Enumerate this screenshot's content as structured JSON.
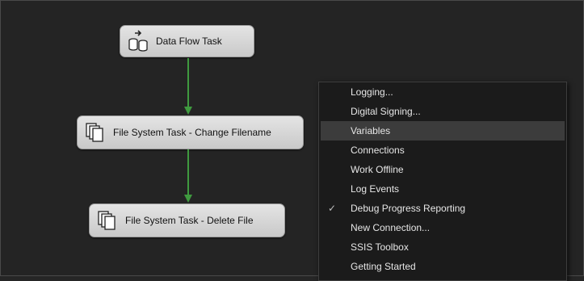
{
  "tasks": [
    {
      "label": "Data Flow Task",
      "icon": "data-flow-icon"
    },
    {
      "label": "File System Task - Change Filename",
      "icon": "file-system-icon"
    },
    {
      "label": "File System Task - Delete File",
      "icon": "file-system-icon"
    }
  ],
  "context_menu": {
    "items": [
      {
        "label": "Logging..."
      },
      {
        "label": "Digital Signing..."
      },
      {
        "label": "Variables",
        "highlighted": true
      },
      {
        "label": "Connections"
      },
      {
        "label": "Work Offline"
      },
      {
        "label": "Log Events"
      },
      {
        "label": "Debug Progress Reporting",
        "checked": true,
        "check_glyph": "✓"
      },
      {
        "label": "New Connection..."
      },
      {
        "label": "SSIS Toolbox"
      },
      {
        "label": "Getting Started"
      }
    ]
  },
  "colors": {
    "canvas": "#242424",
    "connector": "#3f9a3f",
    "task_fill": "#d6d6d6",
    "menu_bg": "#1b1b1b",
    "menu_highlight": "#3c3c3c"
  }
}
